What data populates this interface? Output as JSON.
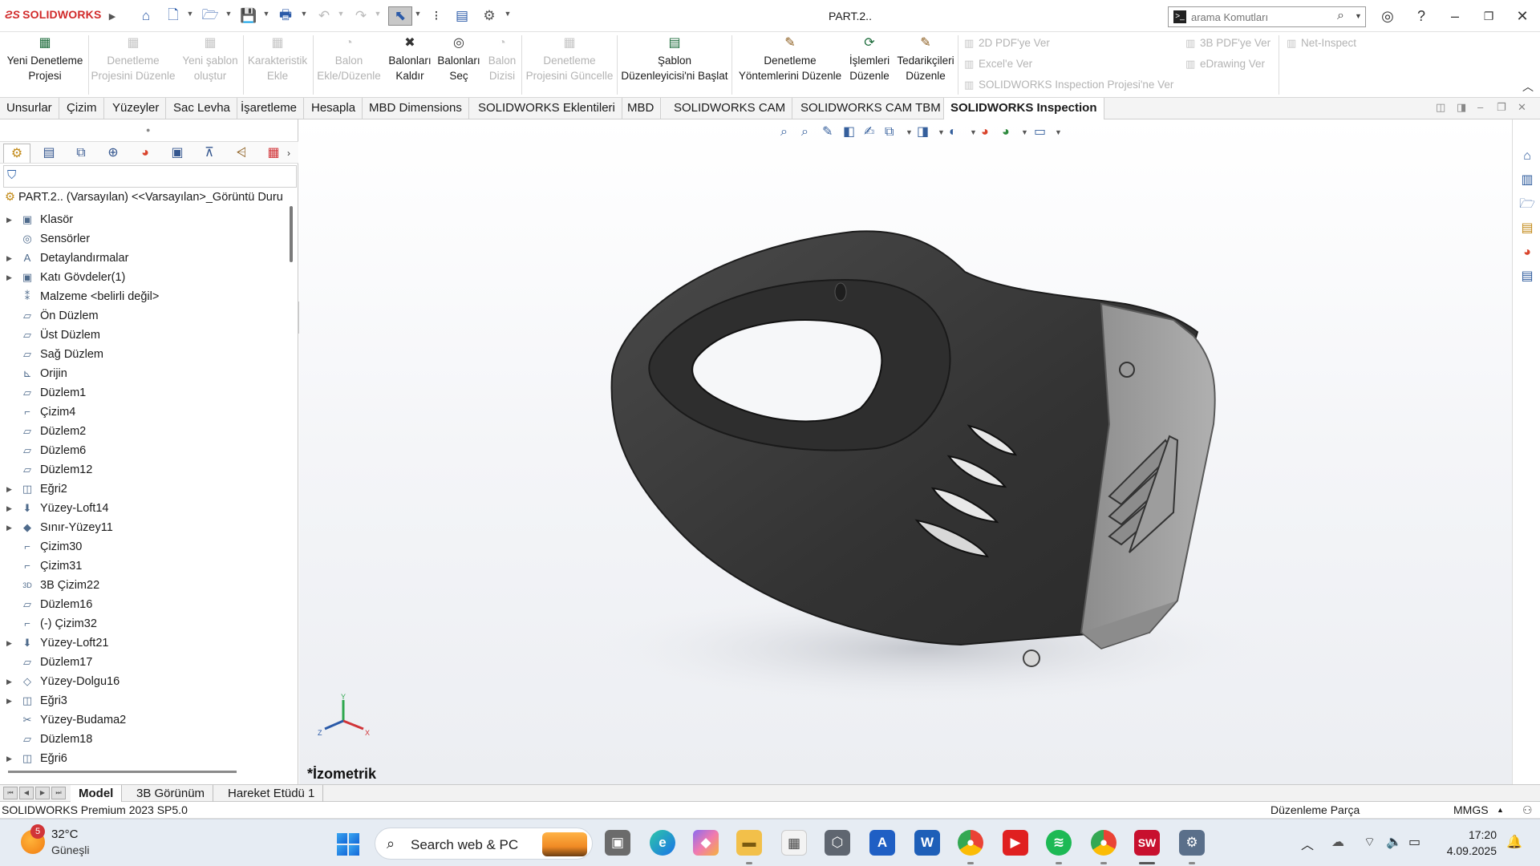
{
  "app": {
    "name": "SOLIDWORKS",
    "window_title": "PART.2.."
  },
  "search": {
    "placeholder": "arama Komutları"
  },
  "ribbon": {
    "items": [
      {
        "label": "Yeni Denetleme\nProjesi",
        "enabled": true
      },
      {
        "label": "Denetleme\nProjesini Düzenle",
        "enabled": false
      },
      {
        "label": "Yeni şablon\noluştur",
        "enabled": false
      },
      {
        "label": "Karakteristik\nEkle",
        "enabled": false
      },
      {
        "label": "Balon\nEkle/Düzenle",
        "enabled": false
      },
      {
        "label": "Balonları\nKaldır",
        "enabled": true
      },
      {
        "label": "Balonları\nSeç",
        "enabled": true
      },
      {
        "label": "Balon\nDizisi",
        "enabled": false
      },
      {
        "label": "Denetleme\nProjesini Güncelle",
        "enabled": false
      },
      {
        "label": "Şablon\nDüzenleyicisi'ni Başlat",
        "enabled": true
      },
      {
        "label": "Denetleme\nYöntemlerini Düzenle",
        "enabled": true
      },
      {
        "label": "İşlemleri\nDüzenle",
        "enabled": true
      },
      {
        "label": "Tedarikçileri\nDüzenle",
        "enabled": true
      }
    ],
    "export_small": [
      {
        "label": "2D PDF'ye Ver"
      },
      {
        "label": "Excel'e Ver"
      },
      {
        "label": "SOLIDWORKS Inspection Projesi'ne Ver"
      },
      {
        "label": "3B PDF'ye Ver"
      },
      {
        "label": "eDrawing Ver"
      },
      {
        "label": "Net-Inspect"
      }
    ]
  },
  "tabs": [
    "Unsurlar",
    "Çizim",
    "Yüzeyler",
    "Sac Levha",
    "İşaretleme",
    "Hesapla",
    "MBD Dimensions",
    "SOLIDWORKS Eklentileri",
    "MBD",
    "SOLIDWORKS CAM",
    "SOLIDWORKS CAM TBM",
    "SOLIDWORKS Inspection"
  ],
  "active_tab": "SOLIDWORKS Inspection",
  "tree": {
    "root": "PART.2.. (Varsayılan) <<Varsayılan>_Görüntü Duru",
    "items": [
      {
        "label": "Klasör",
        "expandable": true,
        "icon": "folder-icon"
      },
      {
        "label": "Sensörler",
        "expandable": false,
        "icon": "sensor-icon"
      },
      {
        "label": "Detaylandırmalar",
        "expandable": true,
        "icon": "annotation-icon"
      },
      {
        "label": "Katı Gövdeler(1)",
        "expandable": true,
        "icon": "solid-bodies-icon"
      },
      {
        "label": "Malzeme <belirli değil>",
        "expandable": false,
        "icon": "material-icon"
      },
      {
        "label": "Ön Düzlem",
        "expandable": false,
        "icon": "plane-icon"
      },
      {
        "label": "Üst Düzlem",
        "expandable": false,
        "icon": "plane-icon"
      },
      {
        "label": "Sağ Düzlem",
        "expandable": false,
        "icon": "plane-icon"
      },
      {
        "label": "Orijin",
        "expandable": false,
        "icon": "origin-icon"
      },
      {
        "label": "Düzlem1",
        "expandable": false,
        "icon": "plane-icon"
      },
      {
        "label": "Çizim4",
        "expandable": false,
        "icon": "sketch-icon"
      },
      {
        "label": "Düzlem2",
        "expandable": false,
        "icon": "plane-icon"
      },
      {
        "label": "Düzlem6",
        "expandable": false,
        "icon": "plane-icon"
      },
      {
        "label": "Düzlem12",
        "expandable": false,
        "icon": "plane-icon"
      },
      {
        "label": "Eğri2",
        "expandable": true,
        "icon": "curve-icon"
      },
      {
        "label": "Yüzey-Loft14",
        "expandable": true,
        "icon": "surface-loft-icon"
      },
      {
        "label": "Sınır-Yüzey11",
        "expandable": true,
        "icon": "boundary-surface-icon"
      },
      {
        "label": "Çizim30",
        "expandable": false,
        "icon": "sketch-icon"
      },
      {
        "label": "Çizim31",
        "expandable": false,
        "icon": "sketch-icon"
      },
      {
        "label": "3B Çizim22",
        "expandable": false,
        "icon": "sketch-3d-icon"
      },
      {
        "label": "Düzlem16",
        "expandable": false,
        "icon": "plane-icon"
      },
      {
        "label": "(-) Çizim32",
        "expandable": false,
        "icon": "sketch-icon"
      },
      {
        "label": "Yüzey-Loft21",
        "expandable": true,
        "icon": "surface-loft-icon"
      },
      {
        "label": "Düzlem17",
        "expandable": false,
        "icon": "plane-icon"
      },
      {
        "label": "Yüzey-Dolgu16",
        "expandable": true,
        "icon": "surface-fill-icon"
      },
      {
        "label": "Eğri3",
        "expandable": true,
        "icon": "curve-icon"
      },
      {
        "label": "Yüzey-Budama2",
        "expandable": false,
        "icon": "surface-trim-icon"
      },
      {
        "label": "Düzlem18",
        "expandable": false,
        "icon": "plane-icon"
      },
      {
        "label": "Eğri6",
        "expandable": true,
        "icon": "curve-icon"
      }
    ]
  },
  "viewport": {
    "view_label": "*İzometrik",
    "triad": {
      "x": "X",
      "y": "Y",
      "z": "Z"
    }
  },
  "bottom_tabs": [
    "Model",
    "3B Görünüm",
    "Hareket Etüdü 1"
  ],
  "active_bottom_tab": "Model",
  "status": {
    "version": "SOLIDWORKS Premium 2023 SP5.0",
    "mode": "Düzenleme Parça",
    "units": "MMGS"
  },
  "taskbar": {
    "weather_temp": "32°C",
    "weather_desc": "Güneşli",
    "weather_badge": "5",
    "search_text": "Search web & PC",
    "time": "17:20",
    "date": "4.09.2025"
  },
  "colors": {
    "brand": "#d12a2a",
    "accent": "#2b5aa8",
    "part_body": "#3c3c3c",
    "part_cap": "#9a9a9a"
  }
}
